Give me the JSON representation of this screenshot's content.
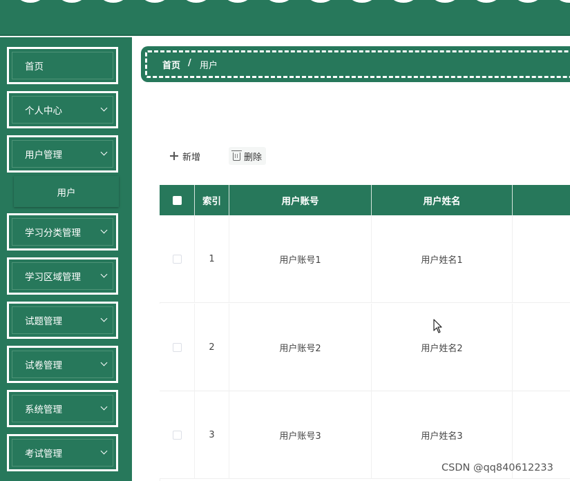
{
  "sidebar": {
    "items": [
      {
        "label": "首页",
        "expandable": false
      },
      {
        "label": "个人中心",
        "expandable": true
      },
      {
        "label": "用户管理",
        "expandable": true,
        "expanded": true
      },
      {
        "label": "学习分类管理",
        "expandable": true
      },
      {
        "label": "学习区域管理",
        "expandable": true
      },
      {
        "label": "试题管理",
        "expandable": true
      },
      {
        "label": "试卷管理",
        "expandable": true
      },
      {
        "label": "系统管理",
        "expandable": true
      },
      {
        "label": "考试管理",
        "expandable": true
      }
    ],
    "submenu": {
      "label": "用户"
    }
  },
  "breadcrumb": {
    "home": "首页",
    "separator": "/",
    "current": "用户"
  },
  "toolbar": {
    "add_label": "新增",
    "delete_label": "删除"
  },
  "table": {
    "columns": [
      "索引",
      "用户账号",
      "用户姓名"
    ],
    "rows": [
      {
        "index": "1",
        "account": "用户账号1",
        "name": "用户姓名1"
      },
      {
        "index": "2",
        "account": "用户账号2",
        "name": "用户姓名2"
      },
      {
        "index": "3",
        "account": "用户账号3",
        "name": "用户姓名3"
      }
    ]
  },
  "watermark": "CSDN @qq840612233",
  "colors": {
    "primary": "#27785b",
    "border": "#ffffff"
  },
  "icons": {
    "add": "plus-icon",
    "delete": "trash-icon",
    "expand": "chevron-down-icon"
  }
}
